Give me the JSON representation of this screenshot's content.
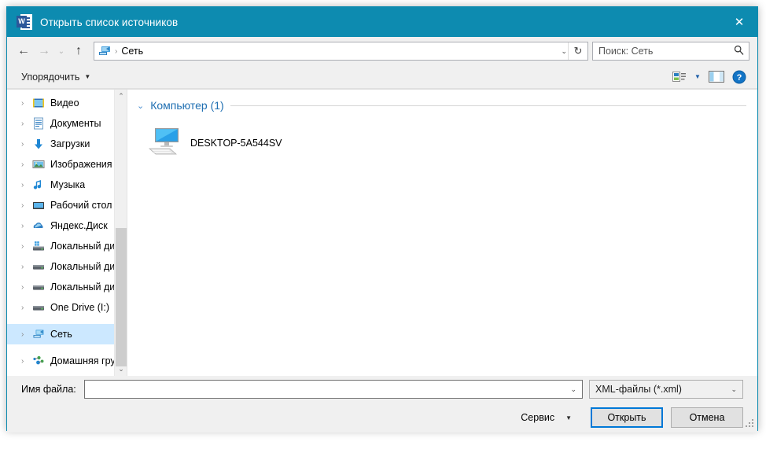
{
  "window": {
    "title": "Открыть список источников",
    "app_icon": "word-icon",
    "close_label": "✕",
    "titlebar_color": "#0d8bb0"
  },
  "nav": {
    "back_label": "←",
    "forward_label": "→",
    "recent_label": "⌄",
    "up_label": "↑",
    "address_icon": "network-icon",
    "address_separator": "›",
    "address_text": "Сеть",
    "address_caret": "⌄",
    "refresh_label": "↻"
  },
  "search": {
    "placeholder": "Поиск: Сеть",
    "value": "",
    "icon": "search-icon"
  },
  "toolbar": {
    "organize_label": "Упорядочить",
    "organize_caret": "▼",
    "view_icon": "view-layout-icon",
    "view_caret": "▼",
    "preview_icon": "preview-pane-icon",
    "help_icon": "help-icon",
    "help_glyph": "?"
  },
  "sidebar": {
    "items": [
      {
        "label": "Видео",
        "icon": "video-folder-icon",
        "chevron": "›",
        "selected": false
      },
      {
        "label": "Документы",
        "icon": "documents-folder-icon",
        "chevron": "›",
        "selected": false
      },
      {
        "label": "Загрузки",
        "icon": "downloads-folder-icon",
        "chevron": "›",
        "selected": false
      },
      {
        "label": "Изображения",
        "icon": "pictures-folder-icon",
        "chevron": "›",
        "selected": false
      },
      {
        "label": "Музыка",
        "icon": "music-folder-icon",
        "chevron": "›",
        "selected": false
      },
      {
        "label": "Рабочий стол",
        "icon": "desktop-icon",
        "chevron": "›",
        "selected": false
      },
      {
        "label": "Яндекс.Диск",
        "icon": "yandex-disk-icon",
        "chevron": "›",
        "selected": false
      },
      {
        "label": "Локальный дис",
        "icon": "system-drive-icon",
        "chevron": "›",
        "selected": false
      },
      {
        "label": "Локальный дис",
        "icon": "drive-icon",
        "chevron": "›",
        "selected": false
      },
      {
        "label": "Локальный дис",
        "icon": "drive-icon",
        "chevron": "›",
        "selected": false
      },
      {
        "label": "One Drive (I:)",
        "icon": "drive-icon",
        "chevron": "›",
        "selected": false
      },
      {
        "label": "Сеть",
        "icon": "network-icon",
        "chevron": "›",
        "selected": true
      },
      {
        "label": "Домашняя групп",
        "icon": "homegroup-icon",
        "chevron": "›",
        "selected": false
      }
    ],
    "scroll_up": "⌃",
    "scroll_down": "⌄"
  },
  "content": {
    "group_label": "Компьютер (1)",
    "group_chevron": "⌄",
    "items": [
      {
        "label": "DESKTOP-5A544SV",
        "icon": "computer-icon"
      }
    ]
  },
  "footer": {
    "filename_label": "Имя файла:",
    "filename_value": "",
    "filename_placeholder": "",
    "filename_caret": "⌄",
    "filetype_value": "XML-файлы (*.xml)",
    "filetype_caret": "⌄",
    "tools_label": "Сервис",
    "tools_caret": "▼",
    "open_label": "Открыть",
    "cancel_label": "Отмена"
  }
}
